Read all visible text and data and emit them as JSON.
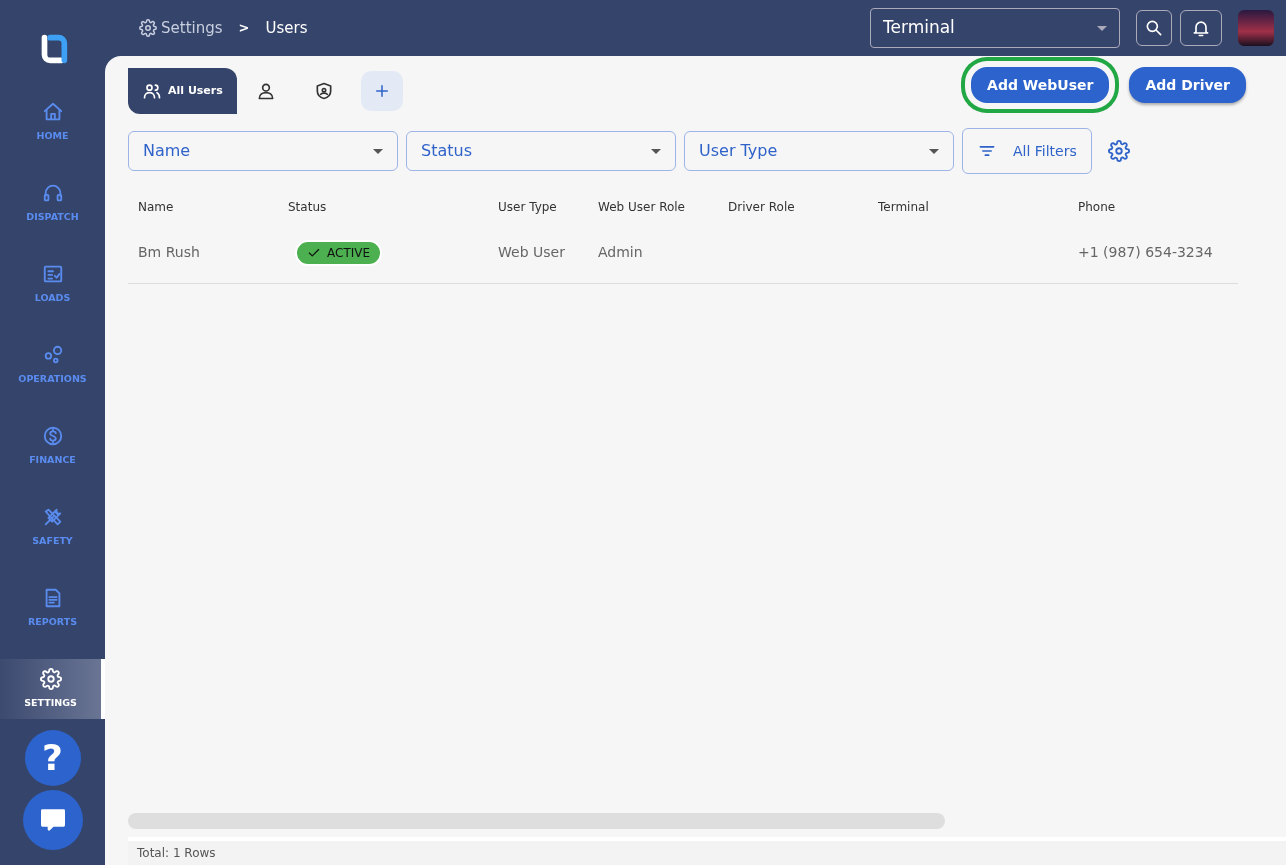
{
  "breadcrumb": {
    "section": "Settings",
    "separator": ">",
    "page": "Users"
  },
  "terminal_select": {
    "value": "Terminal"
  },
  "sidebar": {
    "items": [
      {
        "label": "HOME",
        "selected": false
      },
      {
        "label": "DISPATCH",
        "selected": false
      },
      {
        "label": "LOADS",
        "selected": false
      },
      {
        "label": "OPERATIONS",
        "selected": false
      },
      {
        "label": "FINANCE",
        "selected": false
      },
      {
        "label": "SAFETY",
        "selected": false
      },
      {
        "label": "REPORTS",
        "selected": false
      },
      {
        "label": "SETTINGS",
        "selected": true
      }
    ]
  },
  "help_button": {
    "label": "?"
  },
  "tabs": [
    {
      "label": "All Users",
      "selected": true
    },
    {
      "selected": false
    },
    {
      "selected": false
    }
  ],
  "actions": [
    {
      "label": "Add WebUser",
      "highlighted": true
    },
    {
      "label": "Add Driver",
      "highlighted": false
    }
  ],
  "filters": [
    {
      "placeholder": "Name"
    },
    {
      "placeholder": "Status"
    },
    {
      "placeholder": "User Type"
    }
  ],
  "all_filters": {
    "label": "All Filters"
  },
  "table": {
    "columns": [
      "Name",
      "Status",
      "User Type",
      "Web User Role",
      "Driver Role",
      "Terminal",
      "Phone"
    ],
    "rows": [
      {
        "cells": [
          "Bm Rush",
          "ACTIVE",
          "Web User",
          "Admin",
          "",
          "",
          "+1 (987) 654-3234"
        ],
        "active": true
      }
    ]
  },
  "footer": {
    "total": "Total: 1 Rows"
  }
}
